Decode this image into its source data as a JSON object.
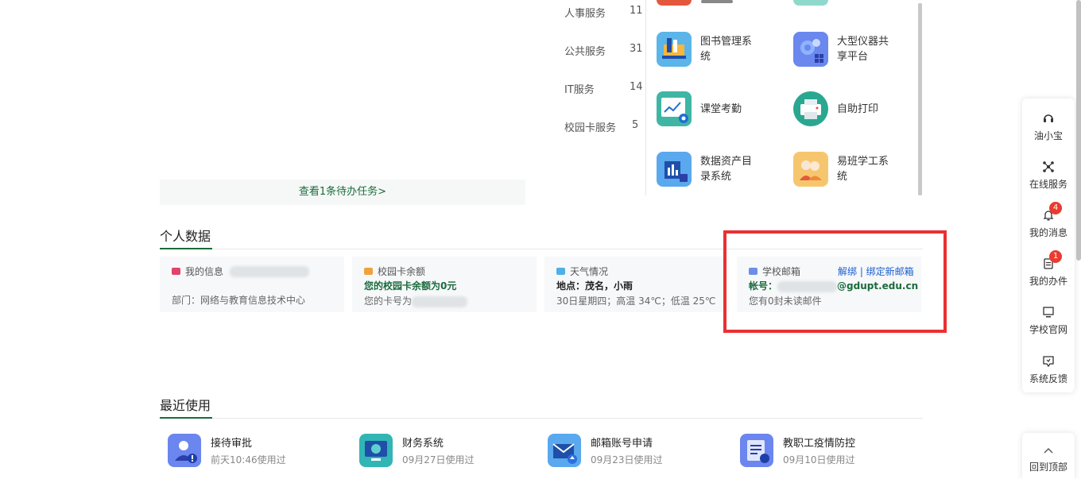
{
  "services": {
    "categories": [
      {
        "label": "人事服务",
        "count": "11"
      },
      {
        "label": "公共服务",
        "count": "31"
      },
      {
        "label": "IT服务",
        "count": "14"
      },
      {
        "label": "校园卡服务",
        "count": "5"
      }
    ],
    "apps": [
      {
        "label": "图书管理系统",
        "icon": "library-icon"
      },
      {
        "label": "大型仪器共享平台",
        "icon": "instrument-share-icon"
      },
      {
        "label": "课堂考勤",
        "icon": "attendance-icon"
      },
      {
        "label": "自助打印",
        "icon": "printer-icon"
      },
      {
        "label": "数据资产目录系统",
        "icon": "data-catalog-icon"
      },
      {
        "label": "易班学工系统",
        "icon": "yiban-icon"
      }
    ],
    "pending_link": "查看1条待办任务>"
  },
  "personal": {
    "title": "个人数据",
    "info": {
      "title": "我的信息",
      "dept": "部门：网络与教育信息技术中心"
    },
    "card": {
      "title": "校园卡余额",
      "balance": "您的校园卡余额为0元",
      "cardno_prefix": "您的卡号为"
    },
    "weather": {
      "title": "天气情况",
      "place": "地点：茂名，小雨",
      "detail": "30日星期四；高温 34℃；低温 25℃"
    },
    "mail": {
      "title": "学校邮箱",
      "actions": "解绑 | 绑定新邮箱",
      "account_prefix": "帐号：",
      "account_suffix": "@gdupt.edu.cn",
      "unread": "您有0封未读邮件"
    }
  },
  "recent": {
    "title": "最近使用",
    "items": [
      {
        "name": "接待审批",
        "time": "前天10:46使用过",
        "icon": "reception-approval-icon"
      },
      {
        "name": "财务系统",
        "time": "09月27日使用过",
        "icon": "finance-icon"
      },
      {
        "name": "邮箱账号申请",
        "time": "09月23日使用过",
        "icon": "mail-apply-icon"
      },
      {
        "name": "教职工疫情防控",
        "time": "09月10日使用过",
        "icon": "epidemic-icon"
      }
    ]
  },
  "toolbar": {
    "items": [
      {
        "label": "油小宝",
        "icon": "headset-icon"
      },
      {
        "label": "在线服务",
        "icon": "network-icon"
      },
      {
        "label": "我的消息",
        "icon": "bell-icon",
        "badge": "4"
      },
      {
        "label": "我的办件",
        "icon": "document-icon",
        "badge": "1"
      },
      {
        "label": "学校官网",
        "icon": "monitor-icon"
      },
      {
        "label": "系统反馈",
        "icon": "feedback-icon"
      }
    ],
    "top": {
      "label": "回到顶部",
      "icon": "chevron-up-icon"
    }
  },
  "colors": {
    "accent": "#1a6b3c",
    "highlight": "#ea3033",
    "badge": "#ea3b2f",
    "link": "#1a5fcf"
  }
}
